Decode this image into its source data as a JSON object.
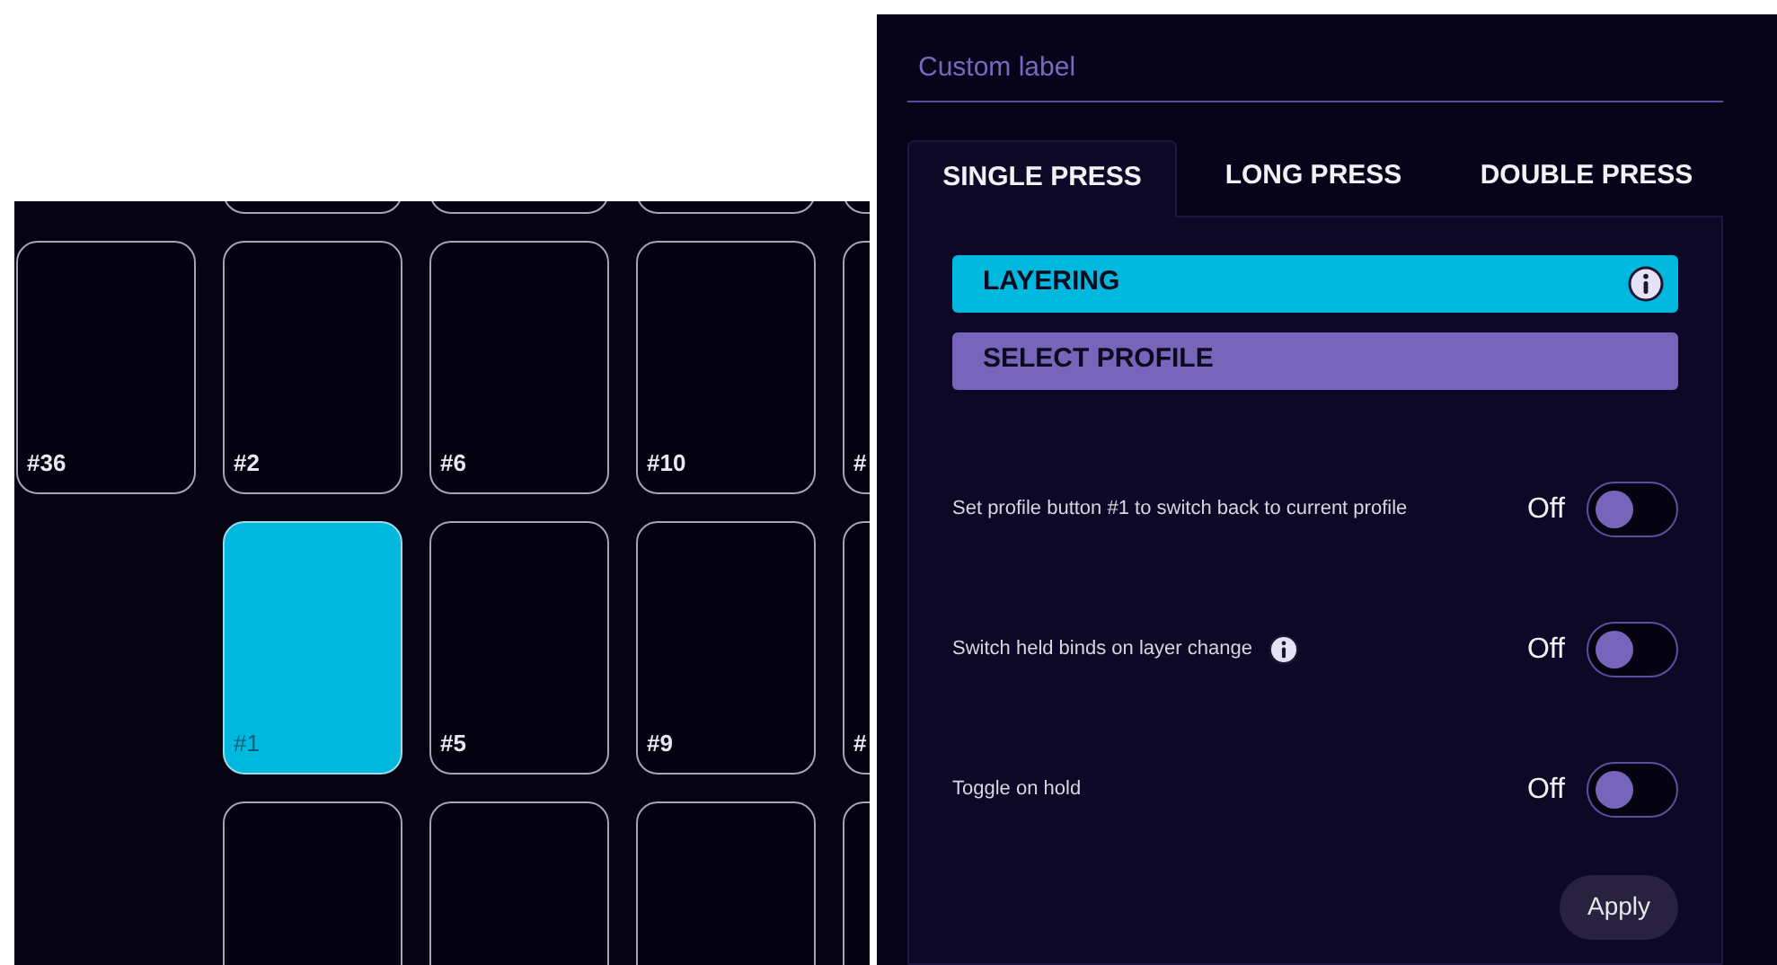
{
  "grid": {
    "rows": [
      {
        "cells": [
          {
            "kind": "blank"
          },
          {
            "kind": "key",
            "selected": false
          },
          {
            "kind": "key",
            "selected": false
          },
          {
            "kind": "key",
            "selected": false
          },
          {
            "kind": "key",
            "selected": false
          }
        ]
      },
      {
        "cells": [
          {
            "kind": "key",
            "label": "#36",
            "selected": false
          },
          {
            "kind": "key",
            "label": "#2",
            "selected": false
          },
          {
            "kind": "key",
            "label": "#6",
            "selected": false
          },
          {
            "kind": "key",
            "label": "#10",
            "selected": false
          },
          {
            "kind": "key",
            "label": "#",
            "selected": false
          }
        ]
      },
      {
        "cells": [
          {
            "kind": "blank"
          },
          {
            "kind": "key",
            "label": "#1",
            "selected": true
          },
          {
            "kind": "key",
            "label": "#5",
            "selected": false
          },
          {
            "kind": "key",
            "label": "#9",
            "selected": false
          },
          {
            "kind": "key",
            "label": "#",
            "selected": false
          }
        ]
      },
      {
        "cells": [
          {
            "kind": "blank"
          },
          {
            "kind": "key",
            "selected": false
          },
          {
            "kind": "key",
            "selected": false
          },
          {
            "kind": "key",
            "selected": false
          },
          {
            "kind": "key",
            "selected": false
          }
        ]
      }
    ]
  },
  "editor": {
    "label_field": {
      "placeholder": "Custom label"
    },
    "tabs": [
      {
        "label": "SINGLE PRESS",
        "selected": true
      },
      {
        "label": "LONG PRESS",
        "selected": false
      },
      {
        "label": "DOUBLE PRESS",
        "selected": false
      }
    ],
    "actions": [
      {
        "label": "LAYERING",
        "color": "#00b8de",
        "info": true
      },
      {
        "label": "SELECT PROFILE",
        "color": "#7765bb",
        "info": false
      }
    ],
    "options": [
      {
        "label": "Set profile button #1 to switch back to current profile",
        "info": false,
        "state": "Off",
        "on": false
      },
      {
        "label": "Switch held binds on layer change",
        "info": true,
        "state": "Off",
        "on": false
      },
      {
        "label": "Toggle on hold",
        "info": false,
        "state": "Off",
        "on": false
      }
    ],
    "apply_button": "Apply"
  }
}
